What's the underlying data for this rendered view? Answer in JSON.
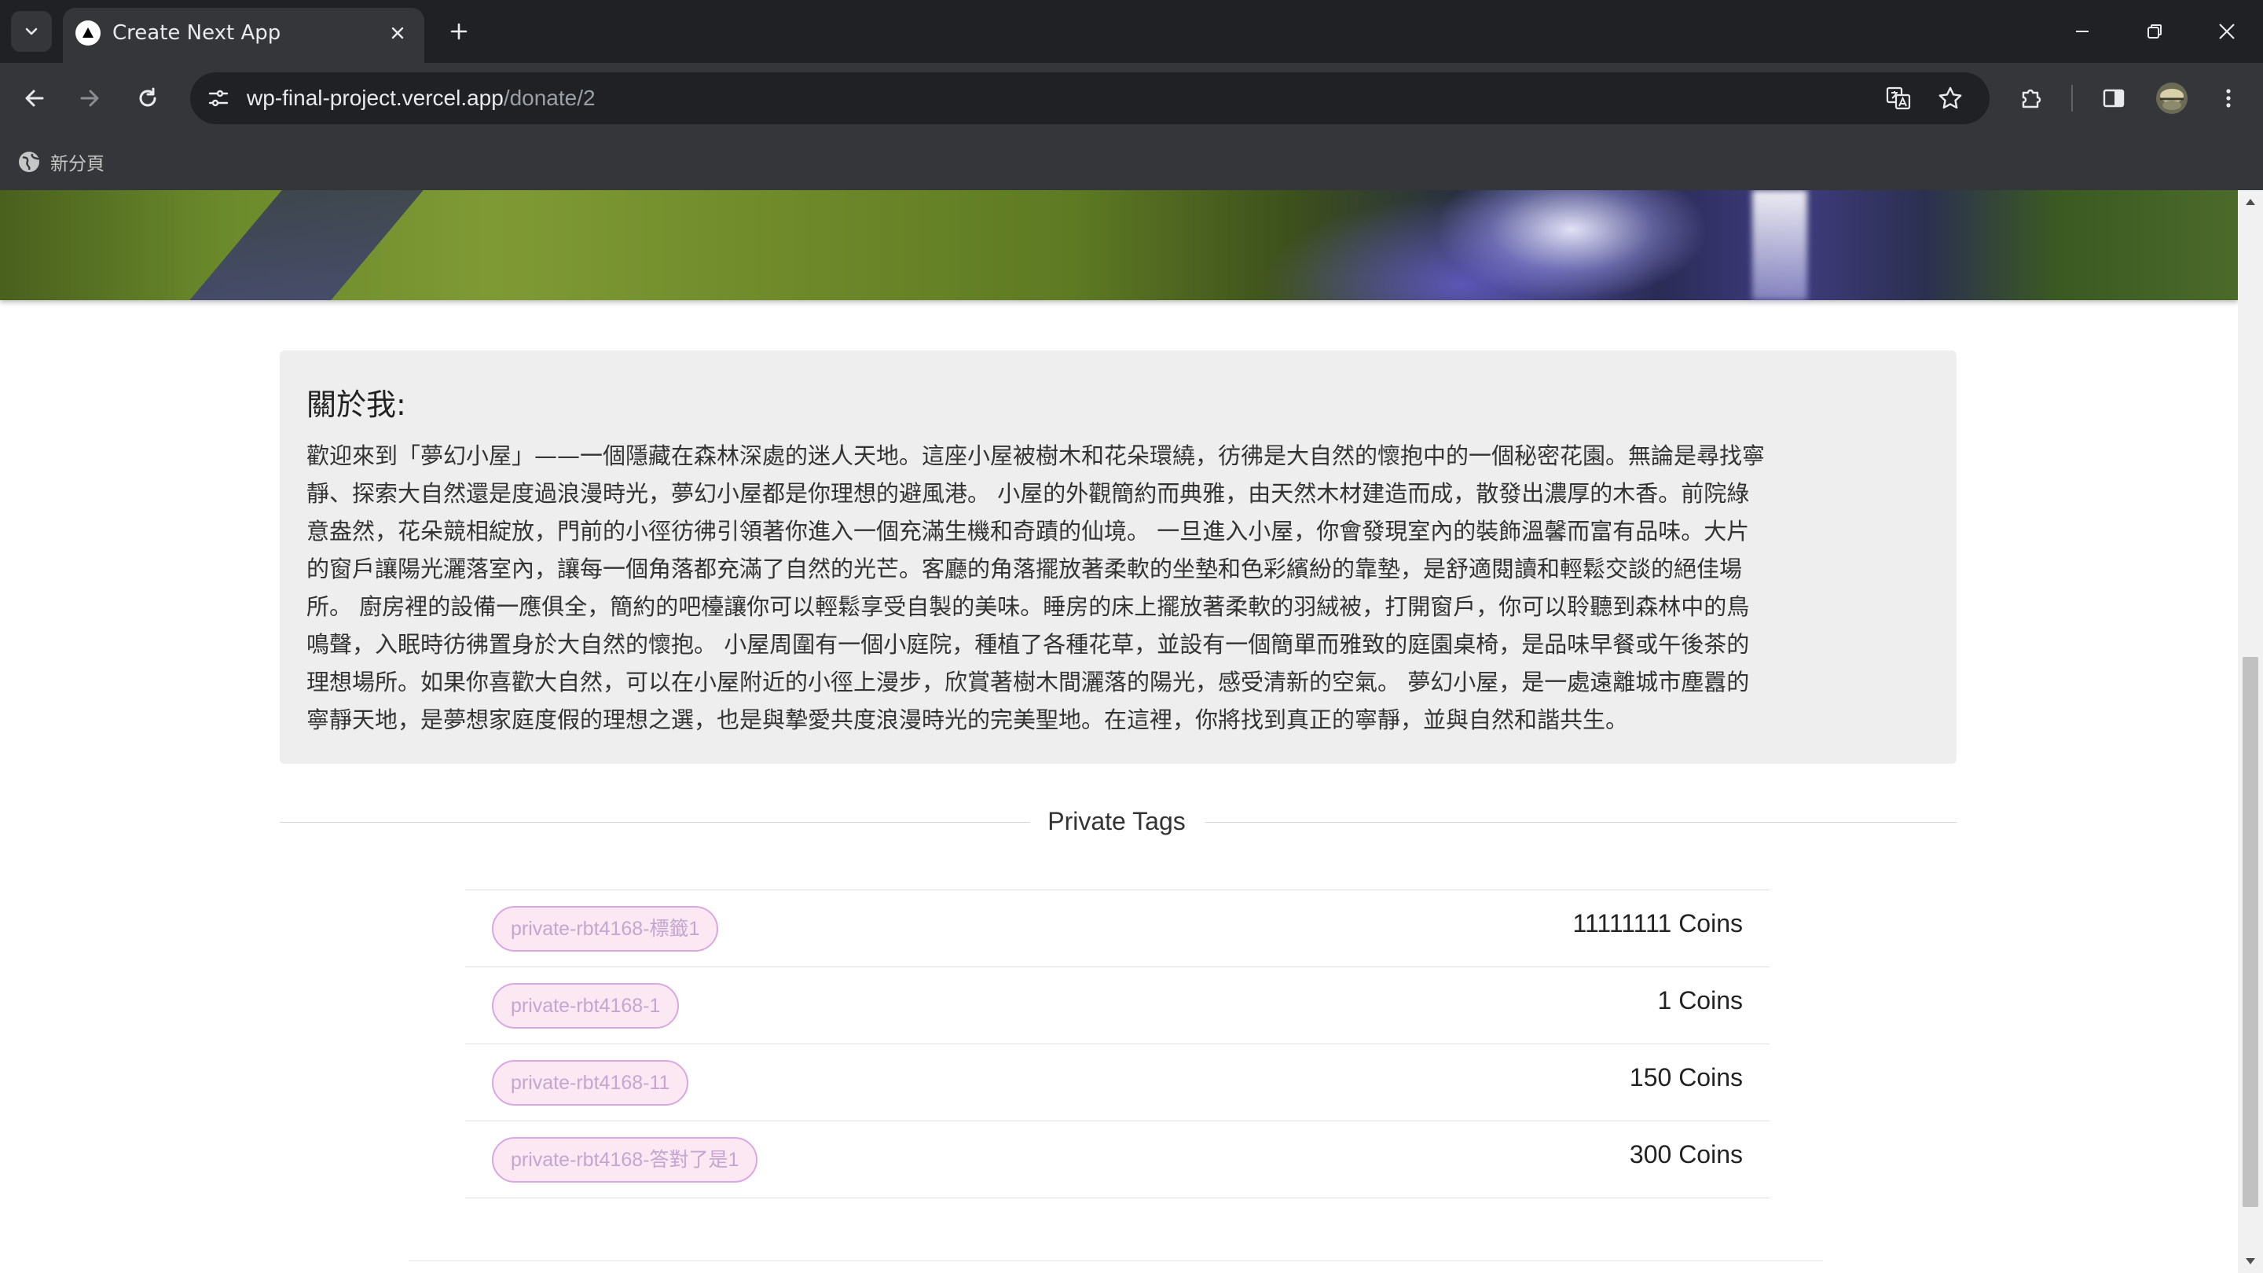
{
  "browser": {
    "tab_title": "Create Next App",
    "url_host": "wp-final-project.vercel.app",
    "url_path": "/donate/2",
    "bookmark_label": "新分頁"
  },
  "icons": {
    "tab_search": "chevron-down-icon",
    "favicon": "triangle-icon",
    "tab_close": "close-icon",
    "new_tab": "plus-icon",
    "minimize": "minimize-icon",
    "restore": "restore-icon",
    "close_window": "close-icon",
    "back": "arrow-left-icon",
    "forward": "arrow-right-icon",
    "reload": "reload-icon",
    "site_info": "tune-icon",
    "translate": "translate-icon",
    "bookmark_star": "star-icon",
    "extensions": "puzzle-icon",
    "side_panel": "side-panel-icon",
    "profile": "avatar-icon",
    "menu": "kebab-menu-icon"
  },
  "about": {
    "title": "關於我:",
    "body": "歡迎來到「夢幻小屋」——一個隱藏在森林深處的迷人天地。這座小屋被樹木和花朵環繞，彷彿是大自然的懷抱中的一個秘密花園。無論是尋找寧\n靜、探索大自然還是度過浪漫時光，夢幻小屋都是你理想的避風港。 小屋的外觀簡約而典雅，由天然木材建造而成，散發出濃厚的木香。前院綠\n意盎然，花朵競相綻放，門前的小徑彷彿引領著你進入一個充滿生機和奇蹟的仙境。 一旦進入小屋，你會發現室內的裝飾溫馨而富有品味。大片\n的窗戶讓陽光灑落室內，讓每一個角落都充滿了自然的光芒。客廳的角落擺放著柔軟的坐墊和色彩繽紛的靠墊，是舒適閱讀和輕鬆交談的絕佳場\n所。 廚房裡的設備一應俱全，簡約的吧檯讓你可以輕鬆享受自製的美味。睡房的床上擺放著柔軟的羽絨被，打開窗戶，你可以聆聽到森林中的鳥\n鳴聲，入眠時彷彿置身於大自然的懷抱。 小屋周圍有一個小庭院，種植了各種花草，並設有一個簡單而雅致的庭園桌椅，是品味早餐或午後茶的\n理想場所。如果你喜歡大自然，可以在小屋附近的小徑上漫步，欣賞著樹木間灑落的陽光，感受清新的空氣。 夢幻小屋，是一處遠離城市塵囂的\n寧靜天地，是夢想家庭度假的理想之選，也是與摯愛共度浪漫時光的完美聖地。在這裡，你將找到真正的寧靜，並與自然和諧共生。"
  },
  "private_tags": {
    "heading": "Private Tags",
    "rows": [
      {
        "tag": "private-rbt4168-標籤1",
        "coins": "11111111 Coins"
      },
      {
        "tag": "private-rbt4168-1",
        "coins": "1 Coins"
      },
      {
        "tag": "private-rbt4168-11",
        "coins": "150 Coins"
      },
      {
        "tag": "private-rbt4168-答對了是1",
        "coins": "300 Coins"
      }
    ]
  }
}
